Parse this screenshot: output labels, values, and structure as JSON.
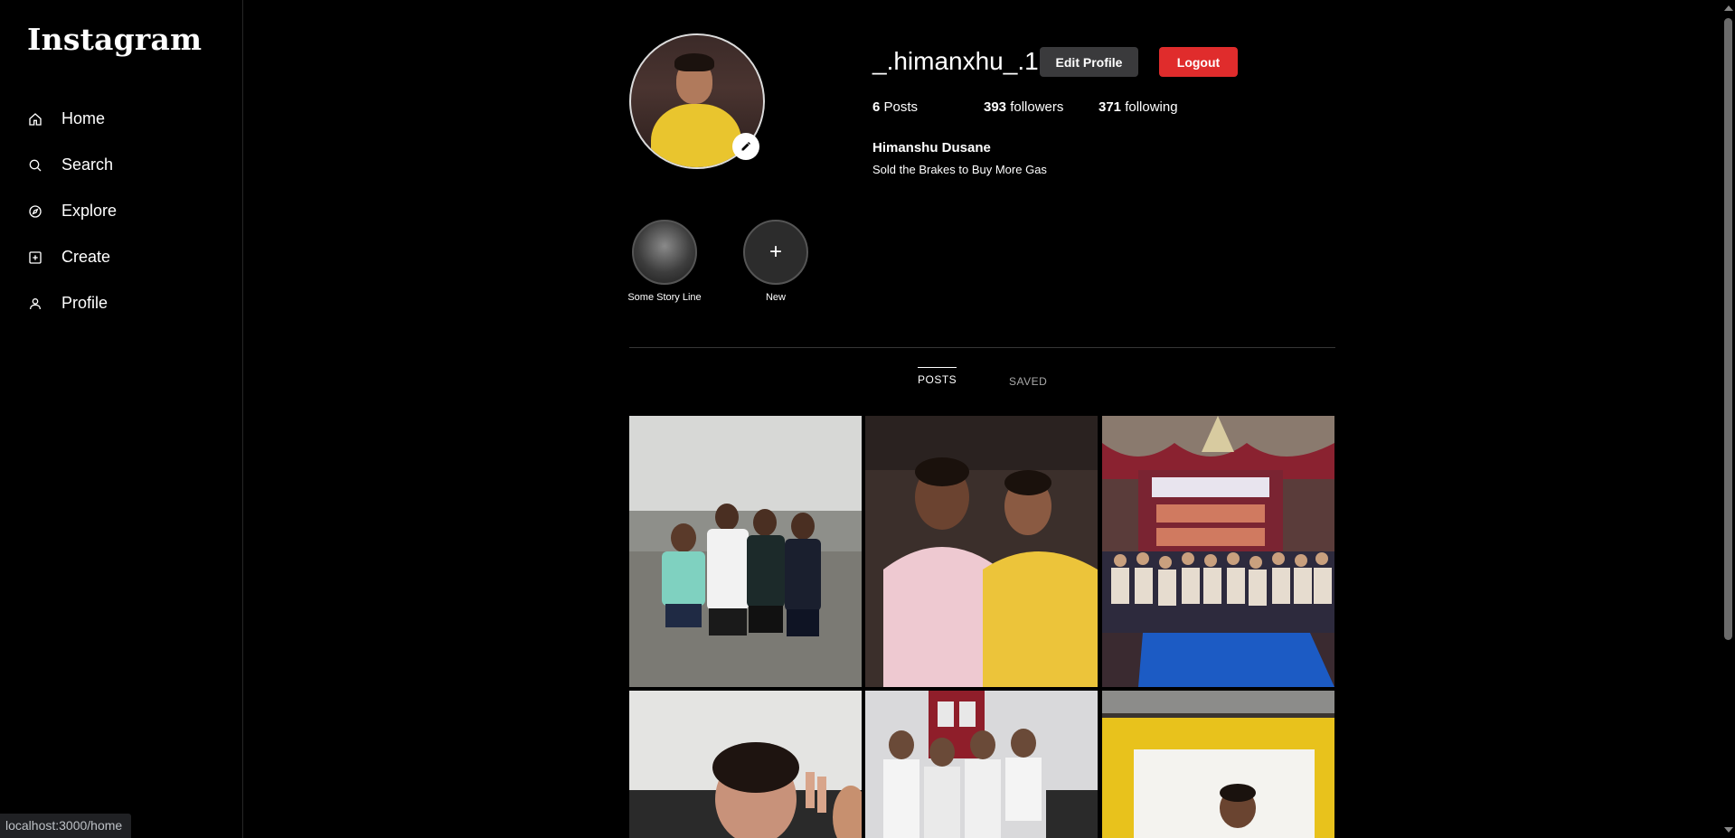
{
  "sidebar": {
    "logo": "Instagram",
    "items": [
      {
        "label": "Home",
        "icon": "home-icon"
      },
      {
        "label": "Search",
        "icon": "search-icon"
      },
      {
        "label": "Explore",
        "icon": "compass-icon"
      },
      {
        "label": "Create",
        "icon": "plus-square-icon"
      },
      {
        "label": "Profile",
        "icon": "user-icon"
      }
    ]
  },
  "profile": {
    "username": "_.himanxhu_.1",
    "edit_profile_label": "Edit Profile",
    "logout_label": "Logout",
    "posts_count": "6",
    "posts_label": "Posts",
    "followers_count": "393",
    "followers_label": "followers",
    "following_count": "371",
    "following_label": "following",
    "full_name": "Himanshu Dusane",
    "bio": "Sold the Brakes to Buy More Gas"
  },
  "highlights": [
    {
      "label": "Some Story Line"
    },
    {
      "label": "New",
      "symbol": "+"
    }
  ],
  "tabs": {
    "posts": "POSTS",
    "saved": "SAVED"
  },
  "status_bar": {
    "url": "localhost:3000/home"
  },
  "colors": {
    "background": "#000000",
    "edit_button": "#3a3a3c",
    "logout_button": "#e02c2c"
  }
}
